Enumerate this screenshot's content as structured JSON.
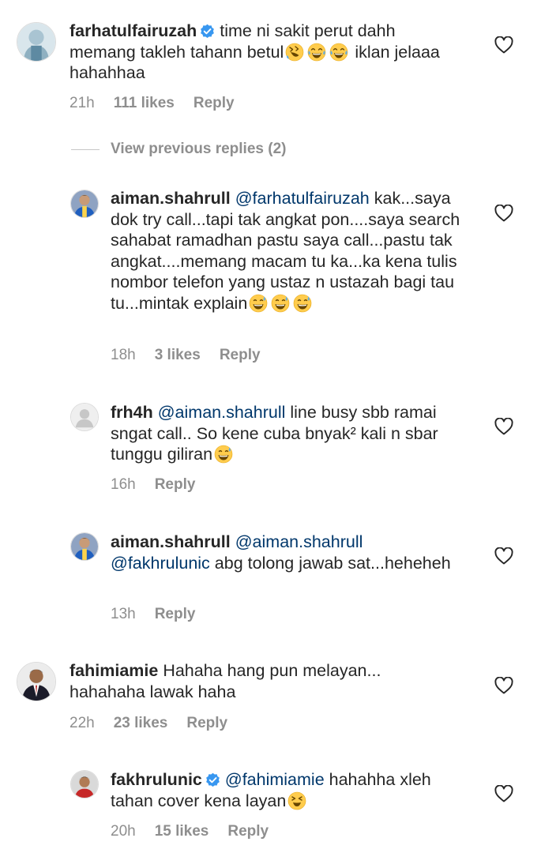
{
  "comments": [
    {
      "username": "farhatulfairuzah",
      "verified": true,
      "mention": "",
      "text": "time ni sakit perut dahh memang takleh tahann betul",
      "text2": "iklan jelaaa hahahhaa",
      "time": "21h",
      "likes": "111 likes",
      "reply": "Reply"
    },
    {
      "username": "aiman.shahrull",
      "mention": "@farhatulfairuzah",
      "text": "kak...saya dok try call...tapi tak angkat pon....saya search sahabat ramadhan pastu saya call...pastu tak angkat....memang macam tu ka...ka kena tulis nombor telefon yang ustaz n ustazah bagi tau tu...mintak explain",
      "time": "18h",
      "likes": "3 likes",
      "reply": "Reply"
    },
    {
      "username": "frh4h",
      "mention": "@aiman.shahrull",
      "text": "line busy sbb ramai sngat call.. So kene cuba bnyak² kali n sbar tunggu giliran",
      "time": "16h",
      "reply": "Reply"
    },
    {
      "username": "aiman.shahrull",
      "mention": "@aiman.shahrull",
      "mention2": "@fakhrulunic",
      "text": "abg tolong jawab sat...heheheh",
      "time": "13h",
      "reply": "Reply"
    },
    {
      "username": "fahimiamie",
      "text": "Hahaha hang pun melayan... hahahaha lawak haha",
      "time": "22h",
      "likes": "23 likes",
      "reply": "Reply"
    },
    {
      "username": "fakhrulunic",
      "verified": true,
      "mention": "@fahimiamie",
      "text": "hahahha xleh tahan cover kena layan",
      "time": "20h",
      "likes": "15 likes",
      "reply": "Reply"
    }
  ],
  "view_previous": "View previous replies (2)",
  "colors": {
    "text": "#262626",
    "meta": "#8e8e8e",
    "mention": "#00376b",
    "verified": "#3897f0"
  }
}
